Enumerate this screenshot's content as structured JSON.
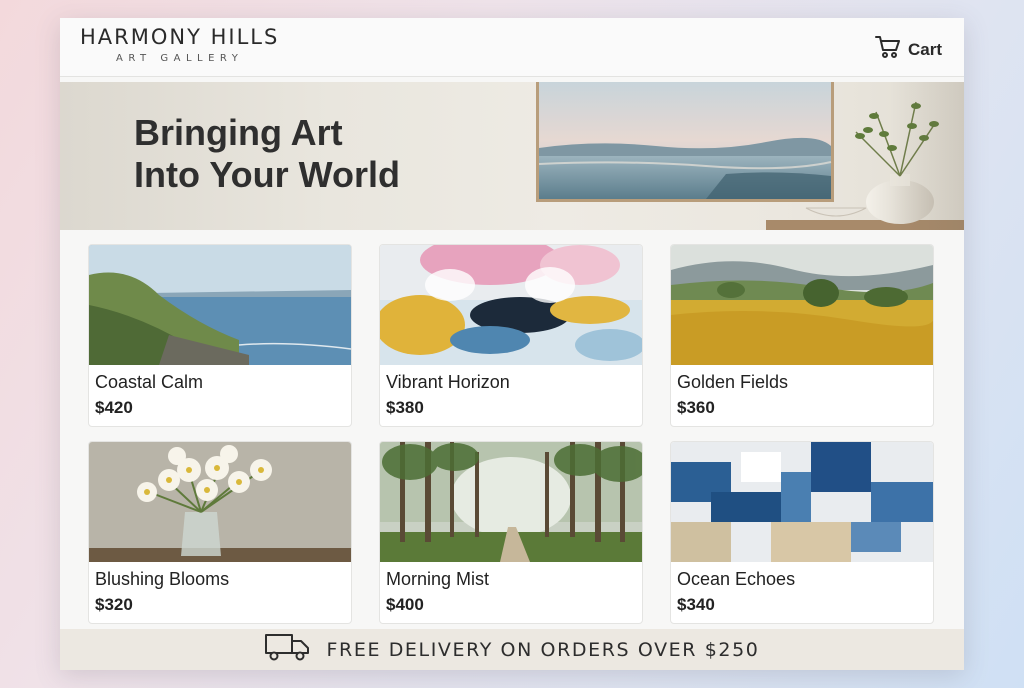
{
  "brand": {
    "name": "HARMONY HILLS",
    "tagline": "ART GALLERY"
  },
  "header": {
    "cart_label": "Cart",
    "cart_icon": "shopping-cart-icon"
  },
  "hero": {
    "line1": "Bringing Art",
    "line2": "Into Your World"
  },
  "products": [
    {
      "title": "Coastal Calm",
      "price": "$420"
    },
    {
      "title": "Vibrant Horizon",
      "price": "$380"
    },
    {
      "title": "Golden Fields",
      "price": "$360"
    },
    {
      "title": "Blushing Blooms",
      "price": "$320"
    },
    {
      "title": "Morning Mist",
      "price": "$400"
    },
    {
      "title": "Ocean Echoes",
      "price": "$340"
    }
  ],
  "banner": {
    "text": "FREE DELIVERY ON ORDERS OVER $250",
    "icon": "delivery-truck-icon"
  }
}
